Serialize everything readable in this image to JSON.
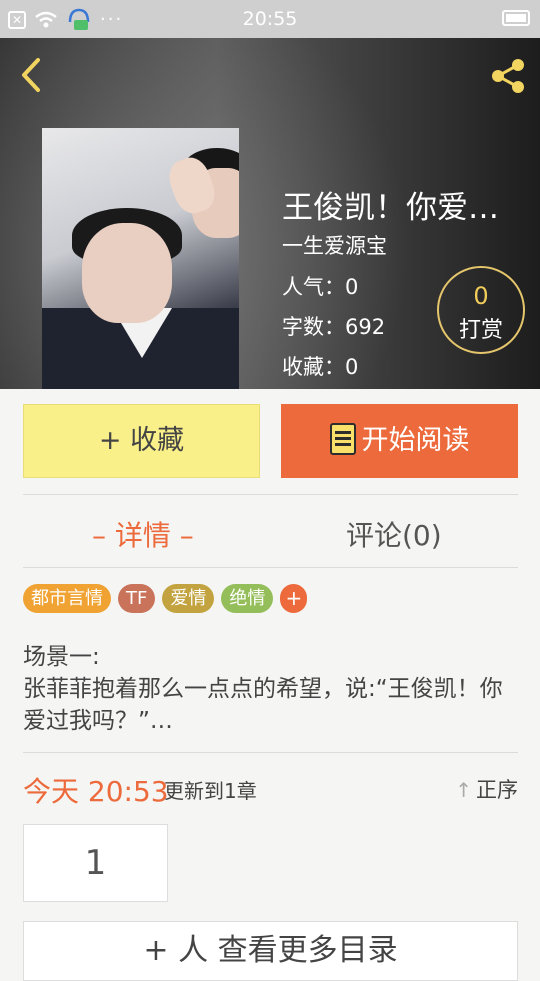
{
  "status_bar": {
    "time": "20:55",
    "icons": [
      "close-box-icon",
      "wifi-icon",
      "message-icon",
      "more-dots-icon",
      "battery-icon"
    ],
    "dots": "···"
  },
  "header": {
    "back_icon": "chevron-left-icon",
    "share_icon": "share-icon",
    "title": "王俊凯！你爱…",
    "author": "一生爱源宝",
    "popularity": "人气：0",
    "word_count": "字数：692",
    "favorites": "收藏：0",
    "reward_count": "0",
    "reward_label": "打赏"
  },
  "actions": {
    "favorite_label": "+ 收藏",
    "read_label": "开始阅读"
  },
  "tabs": [
    {
      "label": "– 详情 –",
      "active": true
    },
    {
      "label": "评论(0)",
      "active": false
    }
  ],
  "tags": [
    {
      "label": "都市言情",
      "color": "#f0a332"
    },
    {
      "label": "TF",
      "color": "#c9735a"
    },
    {
      "label": "爱情",
      "color": "#c3a33f"
    },
    {
      "label": "绝情",
      "color": "#94be5a"
    },
    {
      "label": "+",
      "color": "#ec6a3b"
    }
  ],
  "synopsis": {
    "line1": "场景一:",
    "line2": " 张菲菲抱着那么一点点的希望，说:“王俊凯！你爱过我吗？”…"
  },
  "update": {
    "time": "今天 20:53",
    "text": "更新到1章",
    "sort_label": "正序"
  },
  "chapters": {
    "first": "1",
    "more_label": "+ 人 查看更多目录"
  },
  "colors": {
    "accent": "#ec6a3b",
    "fav_button": "#faf08a",
    "reward_ring": "#e5c66c"
  }
}
